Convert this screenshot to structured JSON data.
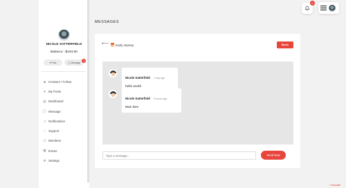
{
  "colors": {
    "accent": "#e8453c",
    "background": "#f2f2f2",
    "chat_bg": "#e6e6e6"
  },
  "profile": {
    "name": "NICOLE SATTERFIELD",
    "balance": "Balance : $104.50"
  },
  "actions": {
    "post_label": "Post",
    "message_label": "Message",
    "message_count": "1"
  },
  "sidebar": {
    "items": [
      {
        "label": "Creators / Follow",
        "icon": "users-icon"
      },
      {
        "label": "My Posts",
        "icon": "heart-icon"
      },
      {
        "label": "Dashboard",
        "icon": "chart-icon"
      },
      {
        "label": "Message",
        "icon": "chat-icon"
      },
      {
        "label": "Notifications",
        "icon": "bell-icon"
      },
      {
        "label": "Support",
        "icon": "heart-outline-icon"
      },
      {
        "label": "Members",
        "icon": "group-icon"
      },
      {
        "label": "Extras",
        "icon": "grid-icon"
      },
      {
        "label": "Settings",
        "icon": "gear-icon"
      }
    ]
  },
  "header": {
    "section_title": "MESSAGES",
    "notification_count": "0"
  },
  "conversation": {
    "peer_name": "Karly Harvey",
    "block_label": "Block",
    "messages": [
      {
        "sender": "Nicole Satterfield",
        "time": "1 day ago",
        "text": "hello world"
      },
      {
        "sender": "Nicole Satterfield",
        "time": "5 hours ago",
        "text": "Man Dev"
      }
    ],
    "input_placeholder": "Type a message...",
    "send_label": "Send Now"
  },
  "footer": {
    "brand": "Fanscafé"
  }
}
